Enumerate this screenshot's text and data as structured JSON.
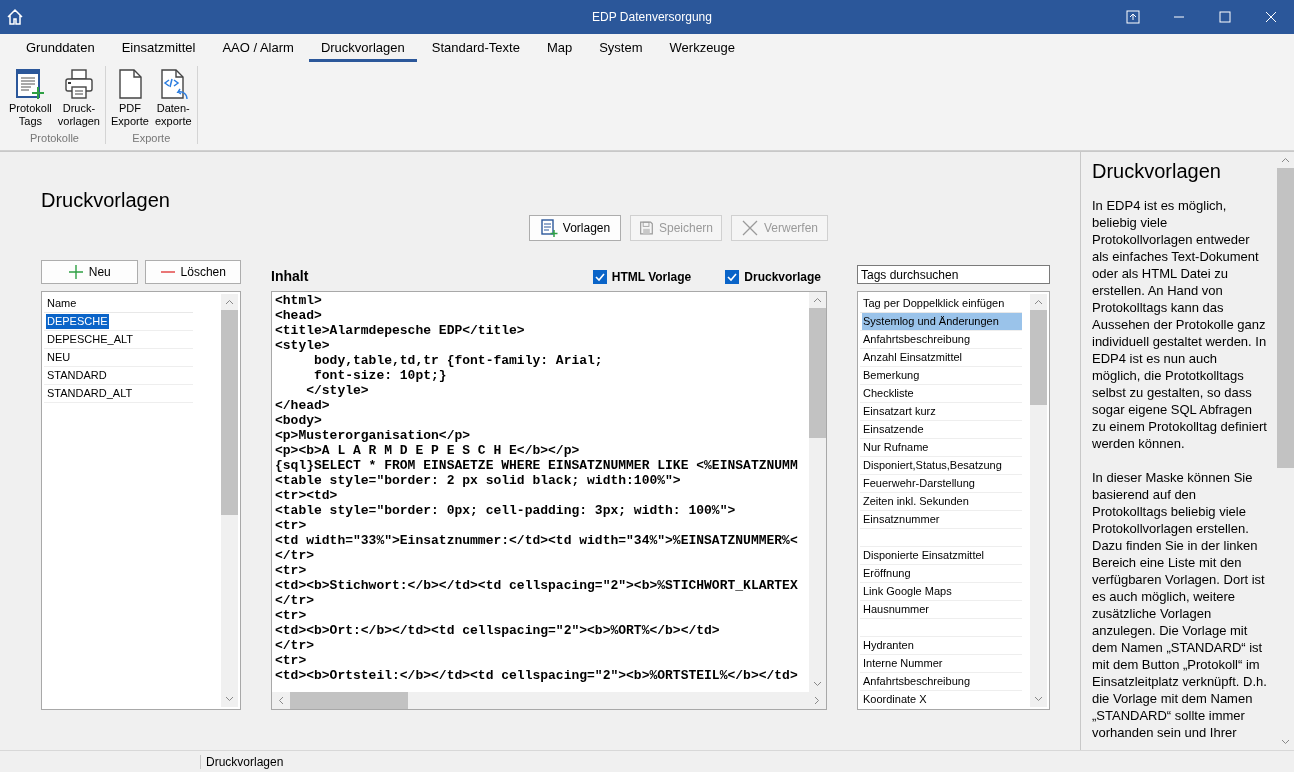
{
  "window": {
    "title": "EDP Datenversorgung"
  },
  "tabs": [
    {
      "label": "Grunddaten",
      "selected": false
    },
    {
      "label": "Einsatzmittel",
      "selected": false
    },
    {
      "label": "AAO / Alarm",
      "selected": false
    },
    {
      "label": "Druckvorlagen",
      "selected": true
    },
    {
      "label": "Standard-Texte",
      "selected": false
    },
    {
      "label": "Map",
      "selected": false
    },
    {
      "label": "System",
      "selected": false
    },
    {
      "label": "Werkzeuge",
      "selected": false
    }
  ],
  "ribbon_groups": [
    {
      "label": "Protokolle",
      "buttons": [
        {
          "label": "Protokoll\nTags"
        },
        {
          "label": "Druck-\nvorlagen"
        }
      ]
    },
    {
      "label": "Exporte",
      "buttons": [
        {
          "label": "PDF\nExporte"
        },
        {
          "label": "Daten-\nexporte"
        }
      ]
    }
  ],
  "page": {
    "heading": "Druckvorlagen",
    "toolbar": [
      {
        "label": "Vorlagen",
        "disabled": false
      },
      {
        "label": "Speichern",
        "disabled": true
      },
      {
        "label": "Verwerfen",
        "disabled": true
      }
    ],
    "template_buttons": [
      {
        "label": "Neu"
      },
      {
        "label": "Löschen"
      }
    ],
    "templates": {
      "column": "Name",
      "rows": [
        {
          "name": "DEPESCHE",
          "selected": true
        },
        {
          "name": "DEPESCHE_ALT",
          "selected": false
        },
        {
          "name": "NEU",
          "selected": false
        },
        {
          "name": "STANDARD",
          "selected": false
        },
        {
          "name": "STANDARD_ALT",
          "selected": false
        }
      ]
    },
    "content": {
      "label": "Inhalt",
      "options": [
        {
          "label": "HTML Vorlage",
          "checked": true
        },
        {
          "label": "Druckvorlage",
          "checked": true
        }
      ],
      "lines": [
        "<html>",
        "<head>",
        "<title>Alarmdepesche EDP</title>",
        "<style>",
        "     body,table,td,tr {font-family: Arial;",
        "     font-size: 10pt;}",
        "    </style>",
        "</head>",
        "<body>",
        "<p>Musterorganisation</p>",
        "<p><b>A L A R M D E P E S C H E</b></p>",
        "{sql}SELECT * FROM EINSAETZE WHERE EINSATZNUMMER LIKE <%EINSATZNUMM",
        "<table style=\"border: 2 px solid black; width:100%\">",
        "<tr><td>",
        "<table style=\"border: 0px; cell-padding: 3px; width: 100%\">",
        "<tr>",
        "<td width=\"33%\">Einsatznummer:</td><td width=\"34%\">%EINSATZNUMMER%<",
        "</tr>",
        "<tr>",
        "<td><b>Stichwort:</b></td><td cellspacing=\"2\"><b>%STICHWORT_KLARTEX",
        "</tr>",
        "<tr>",
        "<td><b>Ort:</b></td><td cellspacing=\"2\"><b>%ORT%</b></td>",
        "</tr>",
        "<tr>",
        "<td><b>Ortsteil:</b></td><td cellspacing=\"2\"><b>%ORTSTEIL%</b></td>"
      ]
    },
    "tags": {
      "placeholder": "Tags durchsuchen",
      "column": "Tag per Doppelklick einfügen",
      "items": [
        {
          "kind": "tag",
          "label": "Systemlog und Änderungen",
          "selected": true
        },
        {
          "kind": "tag",
          "label": "Anfahrtsbeschreibung",
          "selected": false
        },
        {
          "kind": "tag",
          "label": "Anzahl Einsatzmittel",
          "selected": false
        },
        {
          "kind": "tag",
          "label": "Bemerkung",
          "selected": false
        },
        {
          "kind": "tag",
          "label": "Checkliste",
          "selected": false
        },
        {
          "kind": "tag",
          "label": "Einsatzart kurz",
          "selected": false
        },
        {
          "kind": "tag",
          "label": "Einsatzende",
          "selected": false
        },
        {
          "kind": "tag",
          "label": "Nur Rufname",
          "selected": false
        },
        {
          "kind": "tag",
          "label": "Disponiert,Status,Besatzung",
          "selected": false
        },
        {
          "kind": "tag",
          "label": "Feuerwehr-Darstellung",
          "selected": false
        },
        {
          "kind": "tag",
          "label": "Zeiten inkl. Sekunden",
          "selected": false
        },
        {
          "kind": "tag",
          "label": "Einsatznummer",
          "selected": false
        },
        {
          "kind": "blank"
        },
        {
          "kind": "tag",
          "label": "Disponierte Einsatzmittel",
          "selected": false
        },
        {
          "kind": "tag",
          "label": "Eröffnung",
          "selected": false
        },
        {
          "kind": "tag",
          "label": "Link Google Maps",
          "selected": false
        },
        {
          "kind": "tag",
          "label": "Hausnummer",
          "selected": false
        },
        {
          "kind": "blank"
        },
        {
          "kind": "tag",
          "label": "Hydranten",
          "selected": false
        },
        {
          "kind": "tag",
          "label": "Interne Nummer",
          "selected": false
        },
        {
          "kind": "tag",
          "label": "Anfahrtsbeschreibung",
          "selected": false
        },
        {
          "kind": "tag",
          "label": "Koordinate X",
          "selected": false
        }
      ]
    }
  },
  "help": {
    "title": "Druckvorlagen",
    "paragraphs": [
      "In EDP4 ist es möglich, beliebig viele Protokollvorlagen entweder als einfaches Text-Dokument oder als HTML Datei zu erstellen. An Hand von Protokolltags kann das Aussehen der Protokolle ganz individuell gestaltet werden. In EDP4 ist es nun auch möglich, die Prototkolltags selbst zu gestalten, so dass sogar eigene SQL Abfragen zu einem Protokolltag definiert werden können.",
      "In dieser Maske können Sie basierend auf den Protokolltags beliebig viele Protokollvorlagen erstellen. Dazu finden Sie in der linken Bereich eine Liste mit den verfügbaren Vorlagen. Dort ist es auch möglich, weitere zusätzliche Vorlagen anzulegen. Die Vorlage mit dem Namen „STANDARD“ ist mit dem Button „Protokoll“ im Einsatzleitplatz verknüpft. D.h. die Vorlage mit dem Namen „STANDARD“ sollte immer vorhanden sein und Ihrer"
    ]
  },
  "status_bar": {
    "text": "Druckvorlagen"
  }
}
